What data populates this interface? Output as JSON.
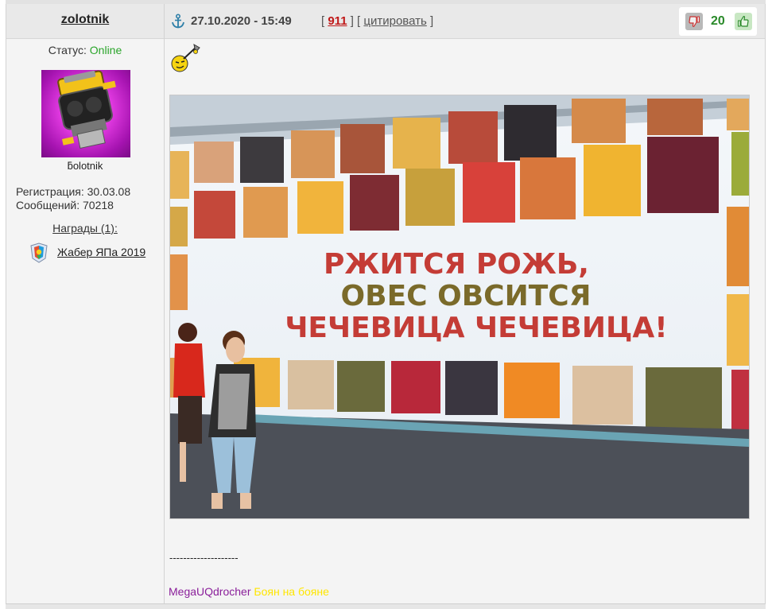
{
  "user": {
    "name": "zolotnik",
    "status_label": "Статус:",
    "status_value": "Online",
    "nick_mirrored": "ƃоlоtnіk",
    "registration": "Регистрация: 30.03.08",
    "messages": "Сообщений: 70218",
    "awards_label": "Награды (1):",
    "award_name": "Жабер ЯПа 2019"
  },
  "post": {
    "date": "27.10.2020 - 15:49",
    "bracket_open_1": "[",
    "number": "911",
    "bracket_mid": "] [",
    "quote_label": "цитировать",
    "bracket_close": "]",
    "rating": "20"
  },
  "image": {
    "line1": "РЖИТСЯ РОЖЬ,",
    "line2": "ОВЕС ОВСИТСЯ",
    "line3": "ЧЕЧЕВИЦА ЧЕЧЕВИЦА!"
  },
  "signature": {
    "separator": "--------------------",
    "part1": "MegaUQdrocher",
    "part2": "Боян на бояне"
  },
  "colors": {
    "online": "#2aa52a",
    "post_number": "#c01818",
    "rating": "#2a8a2a",
    "sig_part1": "#8a1f9a",
    "sig_part2": "#ffe600"
  },
  "icons": [
    "anchor-icon",
    "thumbs-down-icon",
    "thumbs-up-icon",
    "award-icon",
    "smiley-icon"
  ]
}
